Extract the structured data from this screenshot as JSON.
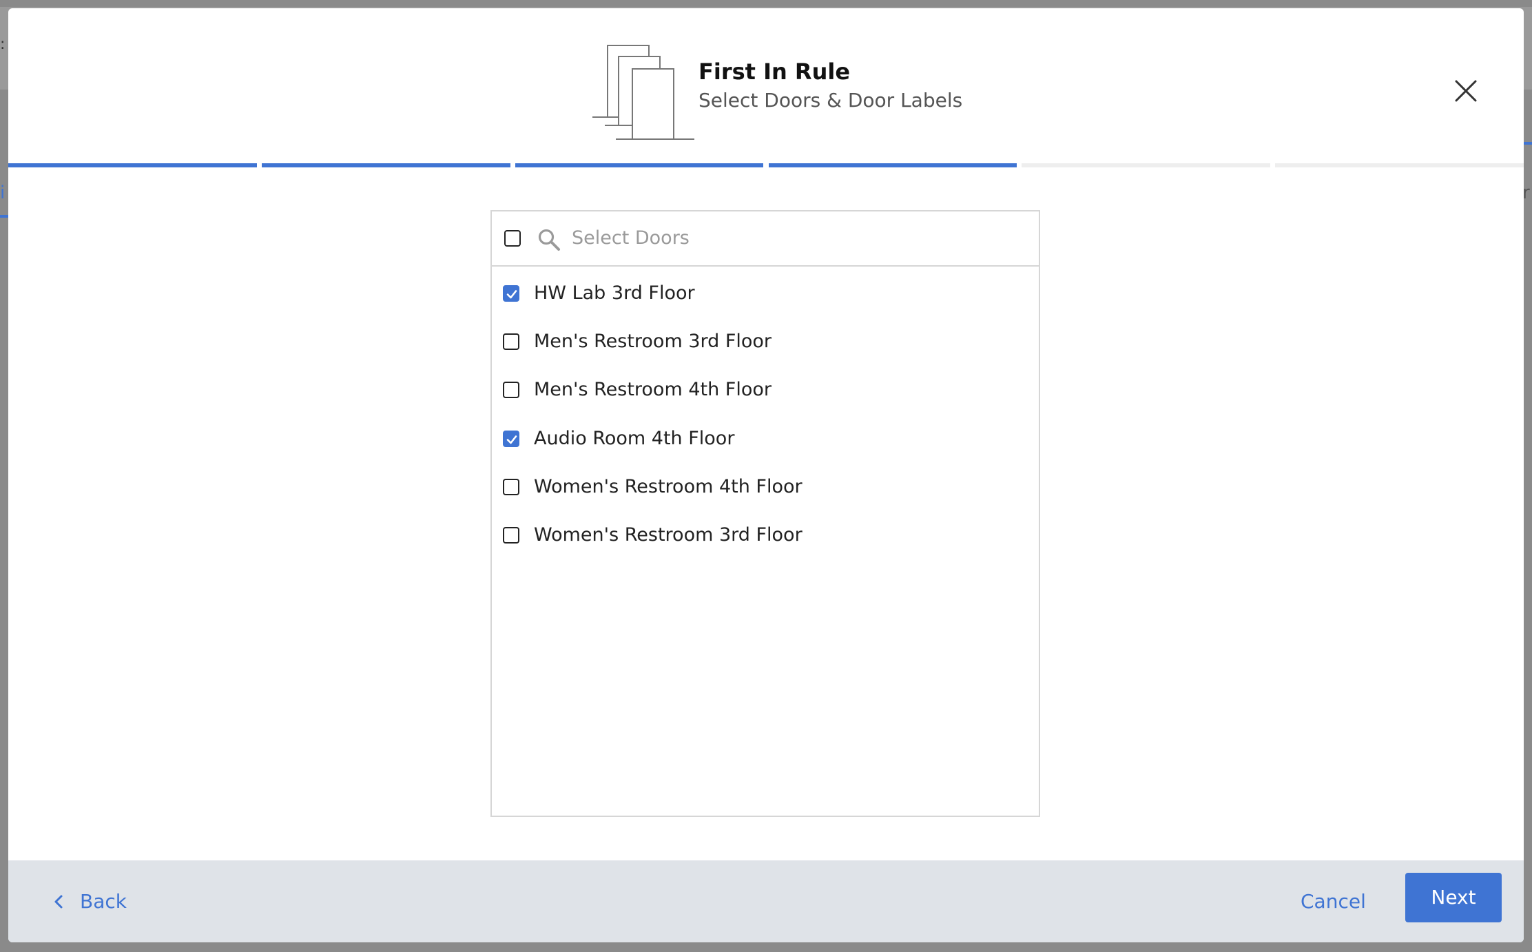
{
  "modal": {
    "title": "First In Rule",
    "subtitle": "Select Doors & Door Labels"
  },
  "progress": {
    "total_steps": 6,
    "completed_steps": 4,
    "colors": {
      "done": "#3f74d3",
      "todo": "#eeeeee"
    }
  },
  "door_selector": {
    "select_all_checked": false,
    "search_placeholder": "Select Doors",
    "search_value": "",
    "doors": [
      {
        "label": "HW Lab 3rd Floor",
        "checked": true
      },
      {
        "label": "Men's Restroom 3rd Floor",
        "checked": false
      },
      {
        "label": "Men's Restroom 4th Floor",
        "checked": false
      },
      {
        "label": "Audio Room 4th Floor",
        "checked": true
      },
      {
        "label": "Women's Restroom 4th Floor",
        "checked": false
      },
      {
        "label": "Women's Restroom 3rd Floor",
        "checked": false
      }
    ]
  },
  "footer": {
    "back_label": "Back",
    "cancel_label": "Cancel",
    "next_label": "Next"
  },
  "colors": {
    "accent": "#3f74d3",
    "footer_bg": "#dfe3e8",
    "overlay": "#8a8a8a"
  },
  "icons": {
    "header": "doors-icon",
    "close": "close-icon",
    "search": "search-icon",
    "back": "chevron-left-icon",
    "checkbox_mark": "checkmark-icon"
  }
}
